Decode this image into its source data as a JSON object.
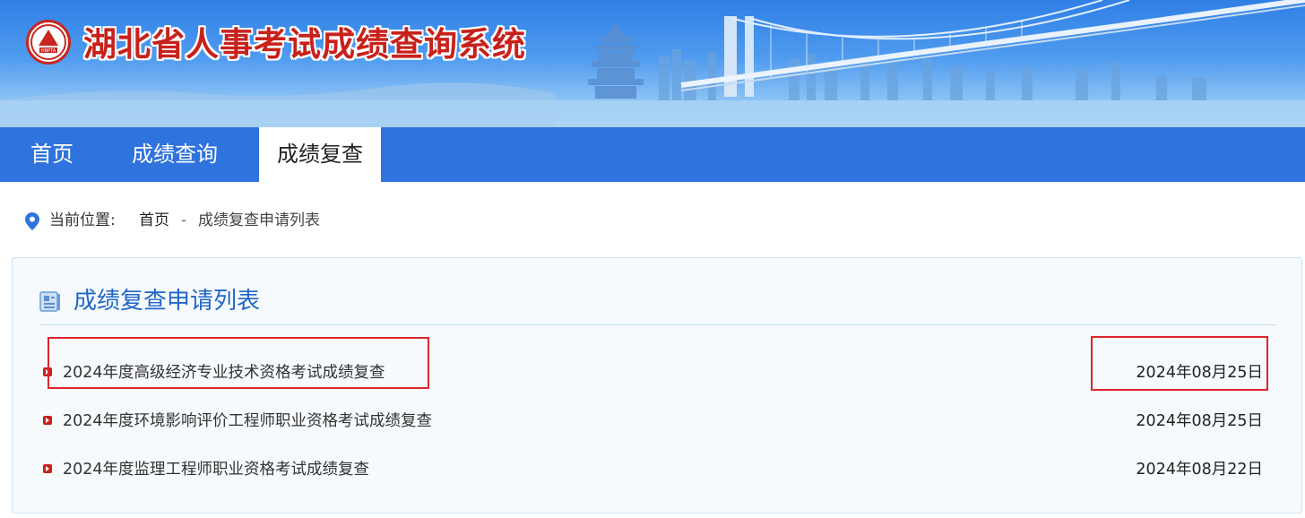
{
  "header": {
    "site_title": "湖北省人事考试成绩查询系统",
    "logo_text": "HBPTA"
  },
  "nav": {
    "items": [
      {
        "label": "首页",
        "active": false
      },
      {
        "label": "成绩查询",
        "active": false
      },
      {
        "label": "成绩复查",
        "active": true
      }
    ]
  },
  "breadcrumb": {
    "label": "当前位置:",
    "home": "首页",
    "separator": "-",
    "current": "成绩复查申请列表"
  },
  "panel": {
    "title": "成绩复查申请列表",
    "items": [
      {
        "title": "2024年度高级经济专业技术资格考试成绩复查",
        "date": "2024年08月25日"
      },
      {
        "title": "2024年度环境影响评价工程师职业资格考试成绩复查",
        "date": "2024年08月25日"
      },
      {
        "title": "2024年度监理工程师职业资格考试成绩复查",
        "date": "2024年08月22日"
      }
    ]
  },
  "colors": {
    "nav_bg": "#2f73de",
    "title_red": "#c8211b",
    "panel_title_blue": "#1f66c8",
    "highlight_red": "#e0242c"
  }
}
